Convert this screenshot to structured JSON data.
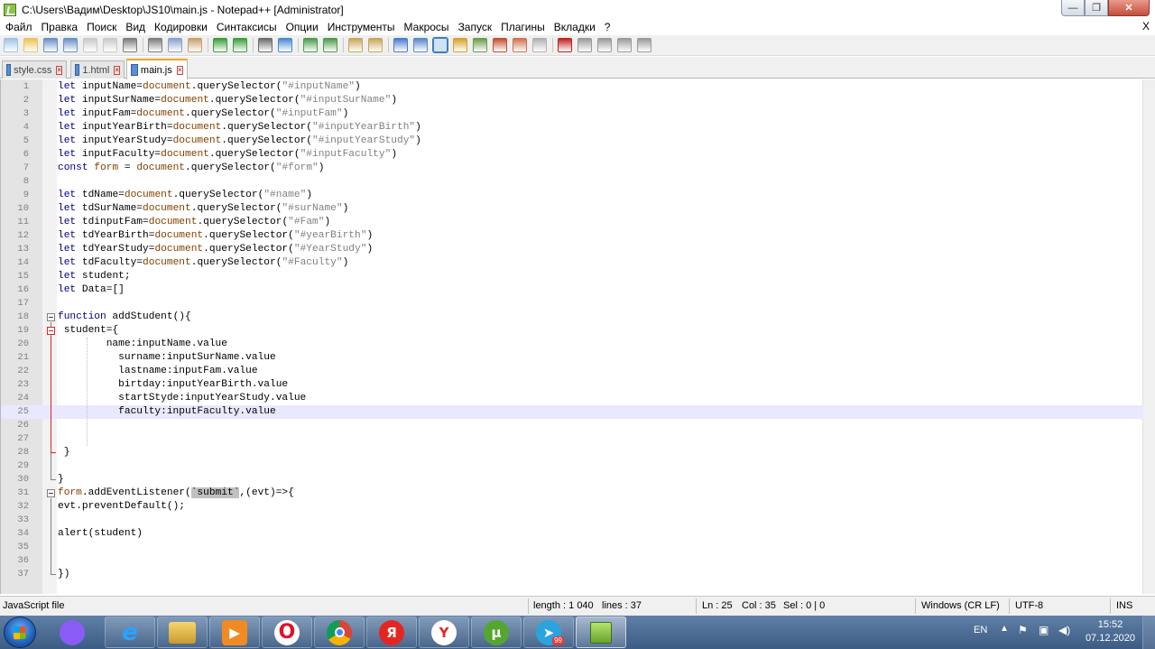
{
  "window": {
    "title": "C:\\Users\\Вадим\\Desktop\\JS10\\main.js - Notepad++ [Administrator]",
    "minimize_glyph": "—",
    "maximize_glyph": "❐",
    "close_glyph": "✕"
  },
  "menu": {
    "items": [
      "Файл",
      "Правка",
      "Поиск",
      "Вид",
      "Кодировки",
      "Синтаксисы",
      "Опции",
      "Инструменты",
      "Макросы",
      "Запуск",
      "Плагины",
      "Вкладки",
      "?"
    ],
    "close_label": "X"
  },
  "toolbar": {
    "icons": [
      "new-file-icon",
      "open-file-icon",
      "save-icon",
      "save-all-icon",
      "close-icon",
      "close-all-icon",
      "print-icon",
      "cut-icon",
      "copy-icon",
      "paste-icon",
      "undo-icon",
      "redo-icon",
      "find-icon",
      "replace-icon",
      "zoom-in-icon",
      "zoom-out-icon",
      "sync-v-icon",
      "sync-h-icon",
      "word-wrap-icon",
      "show-all-chars-icon",
      "indent-guide-icon",
      "udl-icon",
      "doc-map-icon",
      "function-list-icon",
      "folder-workspace-icon",
      "monitor-icon",
      "record-macro-icon",
      "stop-macro-icon",
      "play-macro-icon",
      "play-multiple-icon",
      "save-macro-icon"
    ],
    "active_icon": "indent-guide-icon"
  },
  "tabs": [
    {
      "label": "style.css",
      "active": false
    },
    {
      "label": "1.html",
      "active": false
    },
    {
      "label": "main.js",
      "active": true
    }
  ],
  "editor": {
    "current_line": 25,
    "lines": [
      "let inputName=document.querySelector(\"#inputName\")",
      "let inputSurName=document.querySelector(\"#inputSurName\")",
      "let inputFam=document.querySelector(\"#inputFam\")",
      "let inputYearBirth=document.querySelector(\"#inputYearBirth\")",
      "let inputYearStudy=document.querySelector(\"#inputYearStudy\")",
      "let inputFaculty=document.querySelector(\"#inputFaculty\")",
      "const form = document.querySelector(\"#form\")",
      "",
      "let tdName=document.querySelector(\"#name\")",
      "let tdSurName=document.querySelector(\"#surName\")",
      "let tdinputFam=document.querySelector(\"#Fam\")",
      "let tdYearBirth=document.querySelector(\"#yearBirth\")",
      "let tdYearStudy=document.querySelector(\"#YearStudy\")",
      "let tdFaculty=document.querySelector(\"#Faculty\")",
      "let student;",
      "let Data=[]",
      "",
      "function addStudent(){",
      " student={",
      "        name:inputName.value",
      "          surname:inputSurName.value",
      "          lastname:inputFam.value",
      "          birtday:inputYearBirth.value",
      "          startStyde:inputYearStudy.value",
      "          faculty:inputFaculty.value",
      "",
      "",
      " }",
      "",
      "}",
      "form.addEventListener(`submit`,(evt)=>{",
      "evt.preventDefault();",
      "",
      "alert(student)",
      "",
      "",
      "})"
    ]
  },
  "status": {
    "file_type": "JavaScript file",
    "length": "length : 1 040",
    "lines": "lines : 37",
    "ln": "Ln : 25",
    "col": "Col : 35",
    "sel": "Sel : 0 | 0",
    "eol": "Windows (CR LF)",
    "encoding": "UTF-8",
    "mode": "INS"
  },
  "taskbar": {
    "apps": [
      {
        "name": "alice",
        "glyph": "",
        "color": "#8a5cf6"
      },
      {
        "name": "internet-explorer",
        "glyph": "e",
        "color": "#1a8fe0"
      },
      {
        "name": "file-explorer",
        "glyph": "",
        "color": "#e8c25a"
      },
      {
        "name": "media-player",
        "glyph": "▶",
        "color": "#f08a24"
      },
      {
        "name": "opera",
        "glyph": "O",
        "color": "#e0112b"
      },
      {
        "name": "chrome",
        "glyph": "",
        "color": "#4caf50"
      },
      {
        "name": "yandex-browser",
        "glyph": "Я",
        "color": "#e52620"
      },
      {
        "name": "yandex",
        "glyph": "Y",
        "color": "#ffffff"
      },
      {
        "name": "utorrent",
        "glyph": "µ",
        "color": "#55a630"
      },
      {
        "name": "telegram",
        "glyph": "➤",
        "color": "#2aa3df",
        "badge": "99"
      },
      {
        "name": "notepad-plus-plus",
        "glyph": "",
        "color": "#8bc34a",
        "active": true
      }
    ],
    "language": "EN",
    "time": "15:52",
    "date": "07.12.2020"
  }
}
